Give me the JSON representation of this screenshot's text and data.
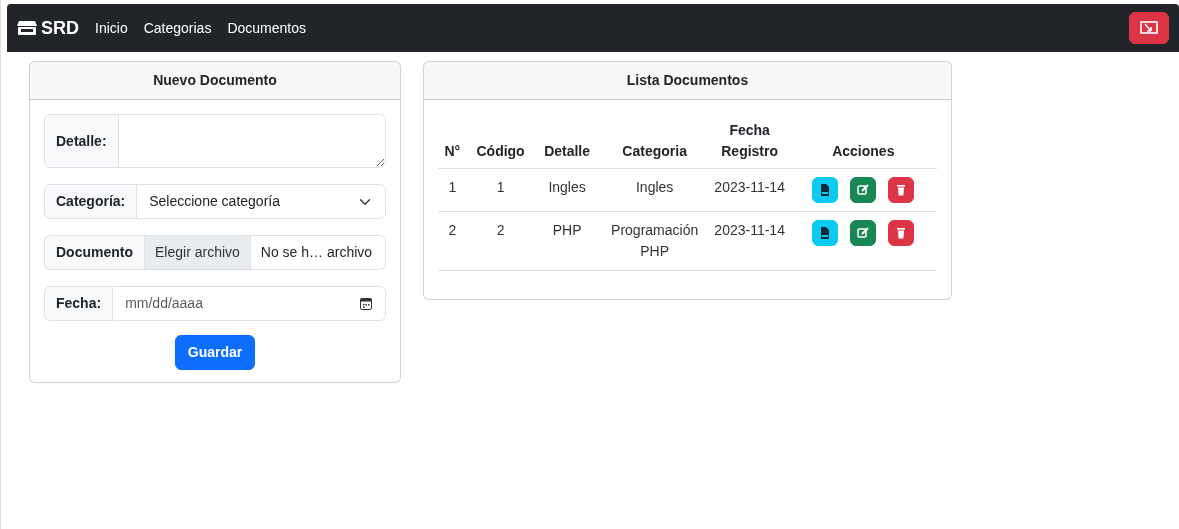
{
  "navbar": {
    "brand": "SRD",
    "links": [
      "Inicio",
      "Categorias",
      "Documentos"
    ]
  },
  "form": {
    "title": "Nuevo Documento",
    "fields": [
      {
        "kind": "textarea",
        "label": "Detalle:"
      },
      {
        "kind": "select",
        "label": "Categoría:",
        "value": "Seleccione categoría"
      },
      {
        "kind": "file",
        "label": "Documento",
        "button": "Elegir archivo",
        "value": "No se h… archivo"
      },
      {
        "kind": "date",
        "label": "Fecha:",
        "placeholder": "mm/dd/aaaa"
      }
    ],
    "submit": "Guardar"
  },
  "list": {
    "title": "Lista Documentos",
    "columns": [
      "N°",
      "Código",
      "Detalle",
      "Categoria",
      "Fecha Registro",
      "Acciones"
    ],
    "rows": [
      {
        "cells": [
          "1",
          "1",
          "Ingles",
          "Ingles",
          "2023-11-14"
        ]
      },
      {
        "cells": [
          "2",
          "2",
          "PHP",
          "Programación PHP",
          "2023-11-14"
        ]
      }
    ]
  }
}
